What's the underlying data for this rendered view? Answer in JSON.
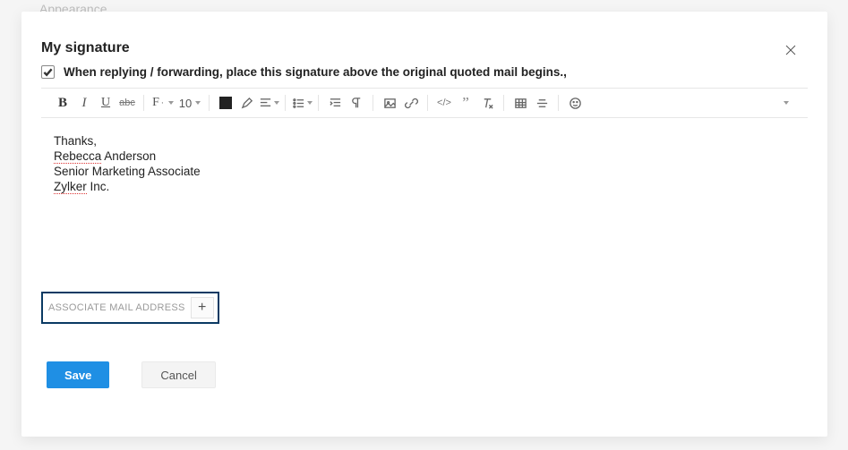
{
  "background_hint": "Appearance",
  "modal": {
    "title": "My signature",
    "checkbox_label": "When replying / forwarding, place this signature above the original quoted mail begins.,",
    "checkbox_checked": true
  },
  "toolbar": {
    "font_label": "F",
    "font_size": "10"
  },
  "editor": {
    "line1": "Thanks,",
    "line2a": "Rebecca",
    "line2b": " Anderson",
    "line3": "Senior Marketing Associate",
    "line4a": "Zylker",
    "line4b": " Inc."
  },
  "associate": {
    "label": "ASSOCIATE MAIL ADDRESS",
    "plus": "+"
  },
  "buttons": {
    "save": "Save",
    "cancel": "Cancel"
  }
}
